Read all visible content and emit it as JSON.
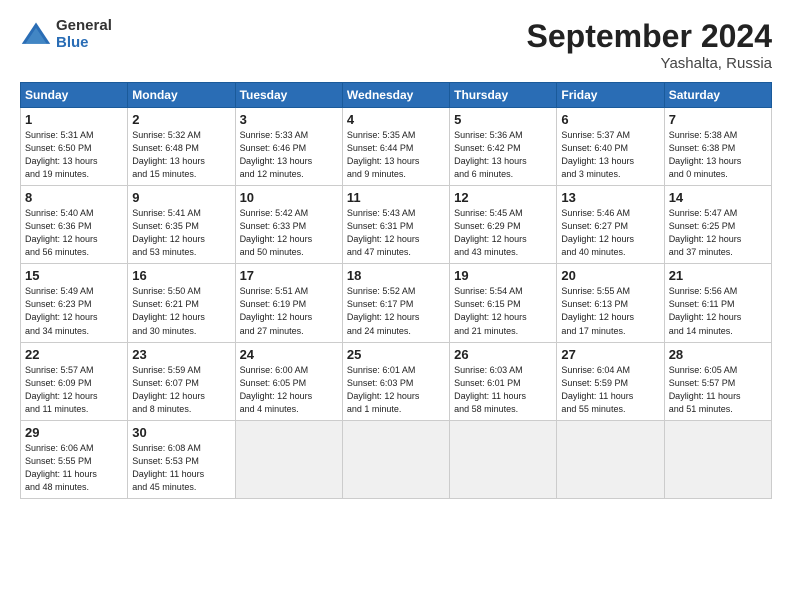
{
  "logo": {
    "general": "General",
    "blue": "Blue"
  },
  "title": "September 2024",
  "subtitle": "Yashalta, Russia",
  "days_of_week": [
    "Sunday",
    "Monday",
    "Tuesday",
    "Wednesday",
    "Thursday",
    "Friday",
    "Saturday"
  ],
  "weeks": [
    [
      {
        "day": "1",
        "info": "Sunrise: 5:31 AM\nSunset: 6:50 PM\nDaylight: 13 hours\nand 19 minutes."
      },
      {
        "day": "2",
        "info": "Sunrise: 5:32 AM\nSunset: 6:48 PM\nDaylight: 13 hours\nand 15 minutes."
      },
      {
        "day": "3",
        "info": "Sunrise: 5:33 AM\nSunset: 6:46 PM\nDaylight: 13 hours\nand 12 minutes."
      },
      {
        "day": "4",
        "info": "Sunrise: 5:35 AM\nSunset: 6:44 PM\nDaylight: 13 hours\nand 9 minutes."
      },
      {
        "day": "5",
        "info": "Sunrise: 5:36 AM\nSunset: 6:42 PM\nDaylight: 13 hours\nand 6 minutes."
      },
      {
        "day": "6",
        "info": "Sunrise: 5:37 AM\nSunset: 6:40 PM\nDaylight: 13 hours\nand 3 minutes."
      },
      {
        "day": "7",
        "info": "Sunrise: 5:38 AM\nSunset: 6:38 PM\nDaylight: 13 hours\nand 0 minutes."
      }
    ],
    [
      {
        "day": "8",
        "info": "Sunrise: 5:40 AM\nSunset: 6:36 PM\nDaylight: 12 hours\nand 56 minutes."
      },
      {
        "day": "9",
        "info": "Sunrise: 5:41 AM\nSunset: 6:35 PM\nDaylight: 12 hours\nand 53 minutes."
      },
      {
        "day": "10",
        "info": "Sunrise: 5:42 AM\nSunset: 6:33 PM\nDaylight: 12 hours\nand 50 minutes."
      },
      {
        "day": "11",
        "info": "Sunrise: 5:43 AM\nSunset: 6:31 PM\nDaylight: 12 hours\nand 47 minutes."
      },
      {
        "day": "12",
        "info": "Sunrise: 5:45 AM\nSunset: 6:29 PM\nDaylight: 12 hours\nand 43 minutes."
      },
      {
        "day": "13",
        "info": "Sunrise: 5:46 AM\nSunset: 6:27 PM\nDaylight: 12 hours\nand 40 minutes."
      },
      {
        "day": "14",
        "info": "Sunrise: 5:47 AM\nSunset: 6:25 PM\nDaylight: 12 hours\nand 37 minutes."
      }
    ],
    [
      {
        "day": "15",
        "info": "Sunrise: 5:49 AM\nSunset: 6:23 PM\nDaylight: 12 hours\nand 34 minutes."
      },
      {
        "day": "16",
        "info": "Sunrise: 5:50 AM\nSunset: 6:21 PM\nDaylight: 12 hours\nand 30 minutes."
      },
      {
        "day": "17",
        "info": "Sunrise: 5:51 AM\nSunset: 6:19 PM\nDaylight: 12 hours\nand 27 minutes."
      },
      {
        "day": "18",
        "info": "Sunrise: 5:52 AM\nSunset: 6:17 PM\nDaylight: 12 hours\nand 24 minutes."
      },
      {
        "day": "19",
        "info": "Sunrise: 5:54 AM\nSunset: 6:15 PM\nDaylight: 12 hours\nand 21 minutes."
      },
      {
        "day": "20",
        "info": "Sunrise: 5:55 AM\nSunset: 6:13 PM\nDaylight: 12 hours\nand 17 minutes."
      },
      {
        "day": "21",
        "info": "Sunrise: 5:56 AM\nSunset: 6:11 PM\nDaylight: 12 hours\nand 14 minutes."
      }
    ],
    [
      {
        "day": "22",
        "info": "Sunrise: 5:57 AM\nSunset: 6:09 PM\nDaylight: 12 hours\nand 11 minutes."
      },
      {
        "day": "23",
        "info": "Sunrise: 5:59 AM\nSunset: 6:07 PM\nDaylight: 12 hours\nand 8 minutes."
      },
      {
        "day": "24",
        "info": "Sunrise: 6:00 AM\nSunset: 6:05 PM\nDaylight: 12 hours\nand 4 minutes."
      },
      {
        "day": "25",
        "info": "Sunrise: 6:01 AM\nSunset: 6:03 PM\nDaylight: 12 hours\nand 1 minute."
      },
      {
        "day": "26",
        "info": "Sunrise: 6:03 AM\nSunset: 6:01 PM\nDaylight: 11 hours\nand 58 minutes."
      },
      {
        "day": "27",
        "info": "Sunrise: 6:04 AM\nSunset: 5:59 PM\nDaylight: 11 hours\nand 55 minutes."
      },
      {
        "day": "28",
        "info": "Sunrise: 6:05 AM\nSunset: 5:57 PM\nDaylight: 11 hours\nand 51 minutes."
      }
    ],
    [
      {
        "day": "29",
        "info": "Sunrise: 6:06 AM\nSunset: 5:55 PM\nDaylight: 11 hours\nand 48 minutes."
      },
      {
        "day": "30",
        "info": "Sunrise: 6:08 AM\nSunset: 5:53 PM\nDaylight: 11 hours\nand 45 minutes."
      },
      {
        "day": "",
        "info": ""
      },
      {
        "day": "",
        "info": ""
      },
      {
        "day": "",
        "info": ""
      },
      {
        "day": "",
        "info": ""
      },
      {
        "day": "",
        "info": ""
      }
    ]
  ]
}
